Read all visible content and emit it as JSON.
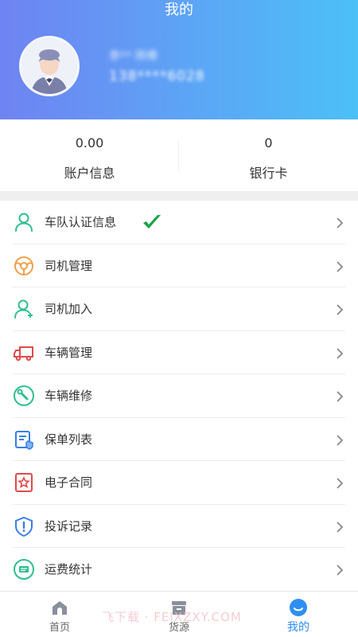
{
  "header": {
    "title": "我的",
    "user_name": "李** 师傅",
    "user_phone": "138****6028"
  },
  "stats": [
    {
      "value": "0.00",
      "label": "账户信息"
    },
    {
      "value": "0",
      "label": "银行卡"
    }
  ],
  "menu": {
    "items": [
      {
        "label": "车队认证信息",
        "icon": "person-outline-icon",
        "verified": true
      },
      {
        "label": "司机管理",
        "icon": "steering-wheel-icon"
      },
      {
        "label": "司机加入",
        "icon": "person-add-icon"
      },
      {
        "label": "车辆管理",
        "icon": "truck-icon"
      },
      {
        "label": "车辆维修",
        "icon": "wrench-icon"
      },
      {
        "label": "保单列表",
        "icon": "policy-document-icon"
      },
      {
        "label": "电子合同",
        "icon": "contract-star-icon"
      },
      {
        "label": "投诉记录",
        "icon": "shield-exclamation-icon"
      },
      {
        "label": "运费统计",
        "icon": "freight-statistics-icon"
      }
    ]
  },
  "tabbar": {
    "items": [
      {
        "label": "首页",
        "icon": "home-icon",
        "active": false
      },
      {
        "label": "货源",
        "icon": "cargo-box-icon",
        "active": false
      },
      {
        "label": "我的",
        "icon": "smile-profile-icon",
        "active": true
      }
    ]
  },
  "watermark": "飞下载 · FEIXZXY.COM",
  "colors": {
    "header_gradient_start": "#6f83f2",
    "header_gradient_end": "#4cc0f7",
    "icon_green": "#2fbf8f",
    "icon_orange": "#f0a04a",
    "icon_red": "#e04a4a",
    "icon_blue": "#3b7fe0",
    "check_green": "#19a447",
    "active_tab": "#2f8ff0"
  }
}
